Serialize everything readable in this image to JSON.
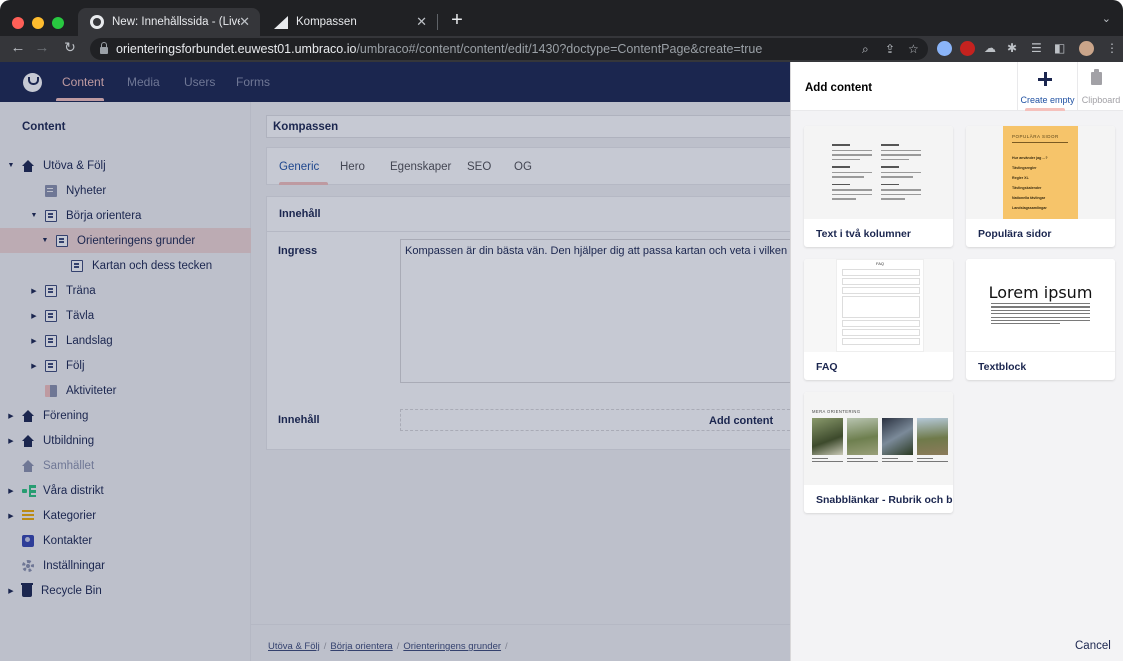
{
  "browser": {
    "tabs": [
      {
        "title": "New: Innehållssida - (Live) Cor",
        "active": true
      },
      {
        "title": "Kompassen",
        "active": false
      }
    ],
    "url_host": "orienteringsforbundet.euwest01.umbraco.io",
    "url_path": "/umbraco#/content/content/edit/1430?doctype=ContentPage&create=true",
    "new_tab_symbol": "+",
    "close_symbol": "✕"
  },
  "header": {
    "sections": [
      "Content",
      "Media",
      "Users",
      "Forms"
    ],
    "active_section": "Content"
  },
  "tree": {
    "title": "Content",
    "nodes": [
      {
        "label": "Utöva & Följ",
        "icon": "house-icon",
        "depth": 0,
        "caret": "down"
      },
      {
        "label": "Nyheter",
        "icon": "news-icon",
        "depth": 1,
        "caret": ""
      },
      {
        "label": "Börja orientera",
        "icon": "page-icon",
        "depth": 1,
        "caret": "down"
      },
      {
        "label": "Orienteringens grunder",
        "icon": "page-icon",
        "depth": 2,
        "caret": "down",
        "selected": true
      },
      {
        "label": "Kartan och dess tecken",
        "icon": "page-icon",
        "depth": 3,
        "caret": ""
      },
      {
        "label": "Träna",
        "icon": "page-icon",
        "depth": 1,
        "caret": "right"
      },
      {
        "label": "Tävla",
        "icon": "page-icon",
        "depth": 1,
        "caret": "right"
      },
      {
        "label": "Landslag",
        "icon": "page-icon",
        "depth": 1,
        "caret": "right"
      },
      {
        "label": "Följ",
        "icon": "page-icon",
        "depth": 1,
        "caret": "right"
      },
      {
        "label": "Aktiviteter",
        "icon": "activities-icon",
        "depth": 1,
        "caret": ""
      },
      {
        "label": "Förening",
        "icon": "house-icon",
        "depth": 0,
        "caret": "right"
      },
      {
        "label": "Utbildning",
        "icon": "house-icon",
        "depth": 0,
        "caret": "right"
      },
      {
        "label": "Samhället",
        "icon": "house-icon-grey",
        "depth": 0,
        "caret": ""
      },
      {
        "label": "Våra distrikt",
        "icon": "network-icon",
        "depth": 0,
        "caret": "right"
      },
      {
        "label": "Kategorier",
        "icon": "list-icon",
        "depth": 0,
        "caret": "right"
      },
      {
        "label": "Kontakter",
        "icon": "contacts-icon",
        "depth": 0,
        "caret": ""
      },
      {
        "label": "Inställningar",
        "icon": "gear-icon",
        "depth": 0,
        "caret": ""
      },
      {
        "label": "Recycle Bin",
        "icon": "trash-icon",
        "depth": 0,
        "caret": "right"
      }
    ]
  },
  "editor": {
    "name_value": "Kompassen",
    "tabs": [
      "Generic",
      "Hero",
      "Egenskaper",
      "SEO",
      "OG"
    ],
    "active_tab": "Generic",
    "group1_title": "Innehåll",
    "ingress_label": "Ingress",
    "ingress_value": "Kompassen är din bästa vän. Den hjälper dig att passa kartan och veta i vilken riktning du ska gå.",
    "content_label": "Innehåll",
    "add_content_label": "Add content",
    "breadcrumb": [
      "Utöva & Följ",
      "Börja orientera",
      "Orienteringens grunder"
    ],
    "breadcrumb_sep": "/"
  },
  "dialog": {
    "title": "Add content",
    "create_empty_label": "Create empty",
    "clipboard_label": "Clipboard",
    "cards": [
      {
        "label": "Text i två kolumner"
      },
      {
        "label": "Populära sidor"
      },
      {
        "label": "FAQ"
      },
      {
        "label": "Textblock"
      },
      {
        "label": "Snabblänkar - Rubrik och bild"
      }
    ],
    "cancel_label": "Cancel",
    "accent_color": "#2152a3",
    "underline_color": "#f5c1bc"
  },
  "thumbs": {
    "popular_title": "POPULÄRA SIDOR",
    "popular_items": [
      "Hur använder jag ...?",
      "Tävlingsregler",
      "Regler XL",
      "Tävlingskalender",
      "Nationella tävlingar",
      "Landslagssamlingar"
    ],
    "faq_title": "FAQ",
    "lorem_title": "Lorem ipsum",
    "quicklinks_title": "MERA ORIENTERING"
  }
}
